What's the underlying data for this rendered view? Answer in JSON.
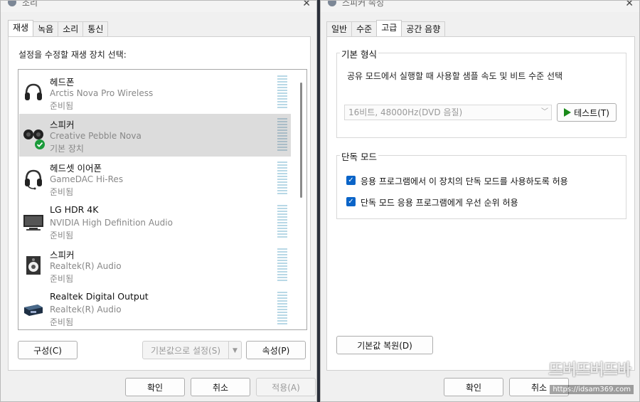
{
  "left_window": {
    "title": "소리",
    "tabs": [
      "재생",
      "녹음",
      "소리",
      "통신"
    ],
    "instruction": "설정을 수정할 재생 장치 선택:",
    "devices": [
      {
        "name": "헤드폰",
        "sub": "Arctis Nova Pro Wireless",
        "status": "준비됨",
        "icon": "headphones-icon",
        "selected": false
      },
      {
        "name": "스피커",
        "sub": "Creative Pebble Nova",
        "status": "기본 장치",
        "icon": "speakers-icon",
        "selected": true,
        "default_check": true
      },
      {
        "name": "헤드셋 이어폰",
        "sub": "GameDAC Hi-Res",
        "status": "준비됨",
        "icon": "headset-icon",
        "selected": false
      },
      {
        "name": "LG HDR 4K",
        "sub": "NVIDIA High Definition Audio",
        "status": "준비됨",
        "icon": "monitor-icon",
        "selected": false
      },
      {
        "name": "스피커",
        "sub": "Realtek(R) Audio",
        "status": "준비됨",
        "icon": "speaker-box-icon",
        "selected": false
      },
      {
        "name": "Realtek Digital Output",
        "sub": "Realtek(R) Audio",
        "status": "준비됨",
        "icon": "digital-output-icon",
        "selected": false
      }
    ],
    "buttons": {
      "configure": "구성(C)",
      "set_default": "기본값으로 설정(S)",
      "properties": "속성(P)",
      "ok": "확인",
      "cancel": "취소",
      "apply": "적용(A)"
    }
  },
  "right_window": {
    "title": "스피커 속성",
    "tabs": [
      "일반",
      "수준",
      "고급",
      "공간 음향"
    ],
    "default_format": {
      "title": "기본 형식",
      "description": "공유 모드에서 실행할 때 사용할 샘플 속도 및 비트 수준 선택",
      "selected": "16비트, 48000Hz(DVD 음질)",
      "test_button": "테스트(T)"
    },
    "exclusive_mode": {
      "title": "단독 모드",
      "options": [
        {
          "label": "응용 프로그램에서 이 장치의 단독 모드를 사용하도록 허용",
          "checked": true
        },
        {
          "label": "단독 모드 응용 프로그램에게 우선 순위 허용",
          "checked": true
        }
      ]
    },
    "buttons": {
      "restore": "기본값 복원(D)",
      "ok": "확인",
      "cancel": "취소"
    }
  },
  "watermark": {
    "logo": "뜨버뜨버뜨바",
    "url": "https://idsam369.com"
  },
  "colors": {
    "accent": "#0a64c8",
    "selected_row": "#dcdcdc",
    "check_green": "#1a9a3a"
  }
}
